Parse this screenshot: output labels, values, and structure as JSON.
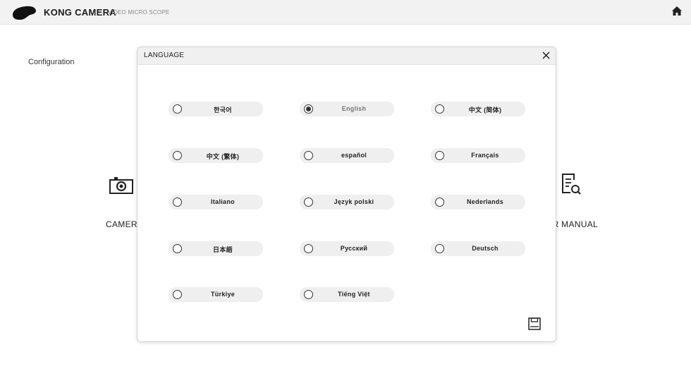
{
  "app": {
    "title": "KONG CAMERA",
    "subtitle": "VIDEO MICRO SCOPE"
  },
  "header": {
    "home_icon": "home-icon"
  },
  "main": {
    "section_title": "Configuration",
    "camera_label": "CAMERA",
    "manual_label": "ER MANUAL"
  },
  "dialog": {
    "title": "LANGUAGE",
    "close_icon": "close-icon",
    "save_icon": "save-icon",
    "selected": "English",
    "options": [
      {
        "label": "한국어"
      },
      {
        "label": "English"
      },
      {
        "label": "中文 (简体)"
      },
      {
        "label": "中文 (繁体)"
      },
      {
        "label": "español"
      },
      {
        "label": "Français"
      },
      {
        "label": "Italiano"
      },
      {
        "label": "Język polski"
      },
      {
        "label": "Nederlands"
      },
      {
        "label": "日本語"
      },
      {
        "label": "Русский"
      },
      {
        "label": "Deutsch"
      },
      {
        "label": "Türkiye"
      },
      {
        "label": "Tiếng Việt"
      }
    ]
  }
}
